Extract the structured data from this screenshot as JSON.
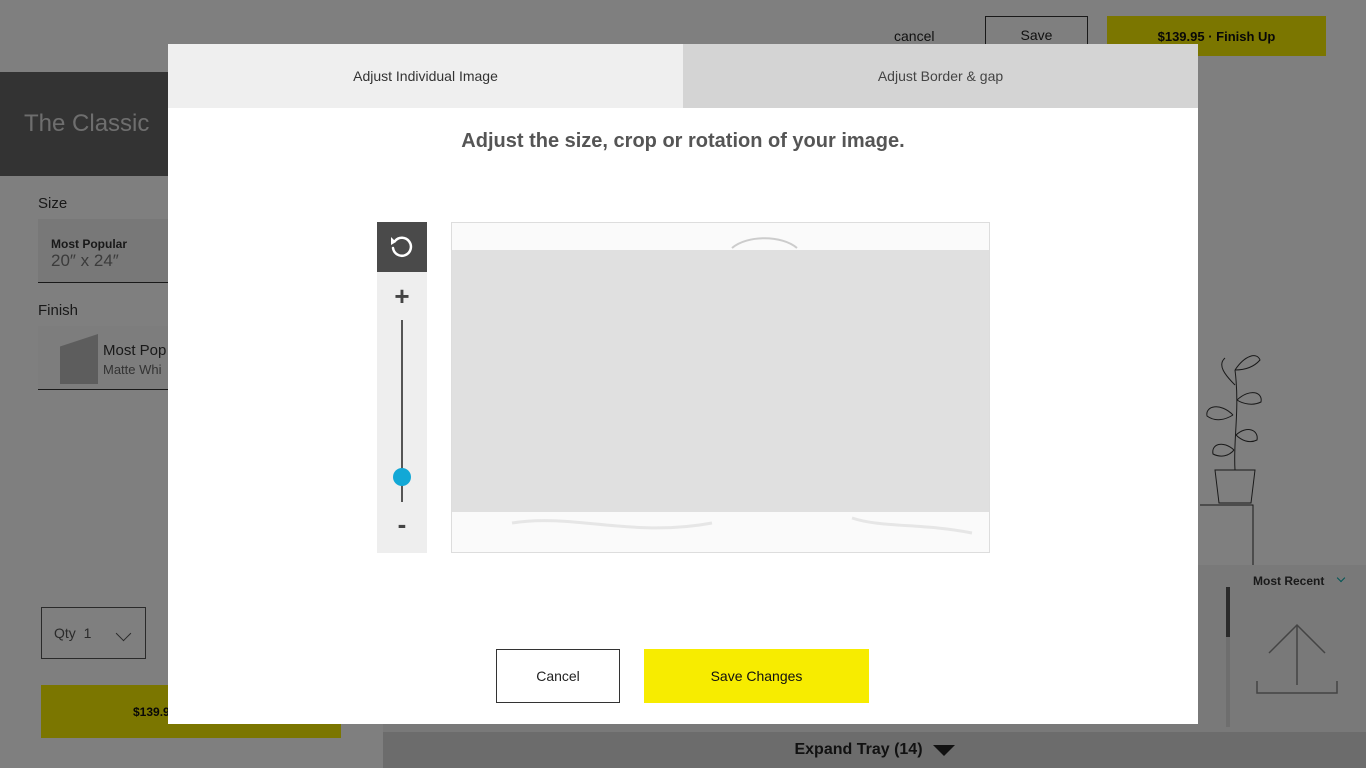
{
  "header": {
    "cancel_label": "cancel",
    "save_label": "Save",
    "finish_label": "$139.95 · Finish Up"
  },
  "sidebar": {
    "title": "The Classic",
    "size_label": "Size",
    "size_popular": "Most Popular",
    "size_value": "20″ x 24″",
    "finish_label": "Finish",
    "finish_popular": "Most Pop",
    "finish_value": "Matte Whi"
  },
  "bottom": {
    "qty_label": "Qty",
    "qty_value": "1",
    "add_price": "$139.9"
  },
  "tray": {
    "sort_label": "Most Recent",
    "expand_label": "Expand Tray (14)"
  },
  "modal": {
    "tabs": [
      {
        "label": "Adjust Individual Image",
        "active": true
      },
      {
        "label": "Adjust Border & gap",
        "active": false
      }
    ],
    "heading": "Adjust the size, crop or rotation of your image.",
    "zoom_plus": "+",
    "zoom_minus": "-",
    "zoom_level": 0.14,
    "cancel_label": "Cancel",
    "save_label": "Save Changes"
  },
  "colors": {
    "accent_yellow": "#f7ec00",
    "slider_blue": "#12a8d6"
  }
}
